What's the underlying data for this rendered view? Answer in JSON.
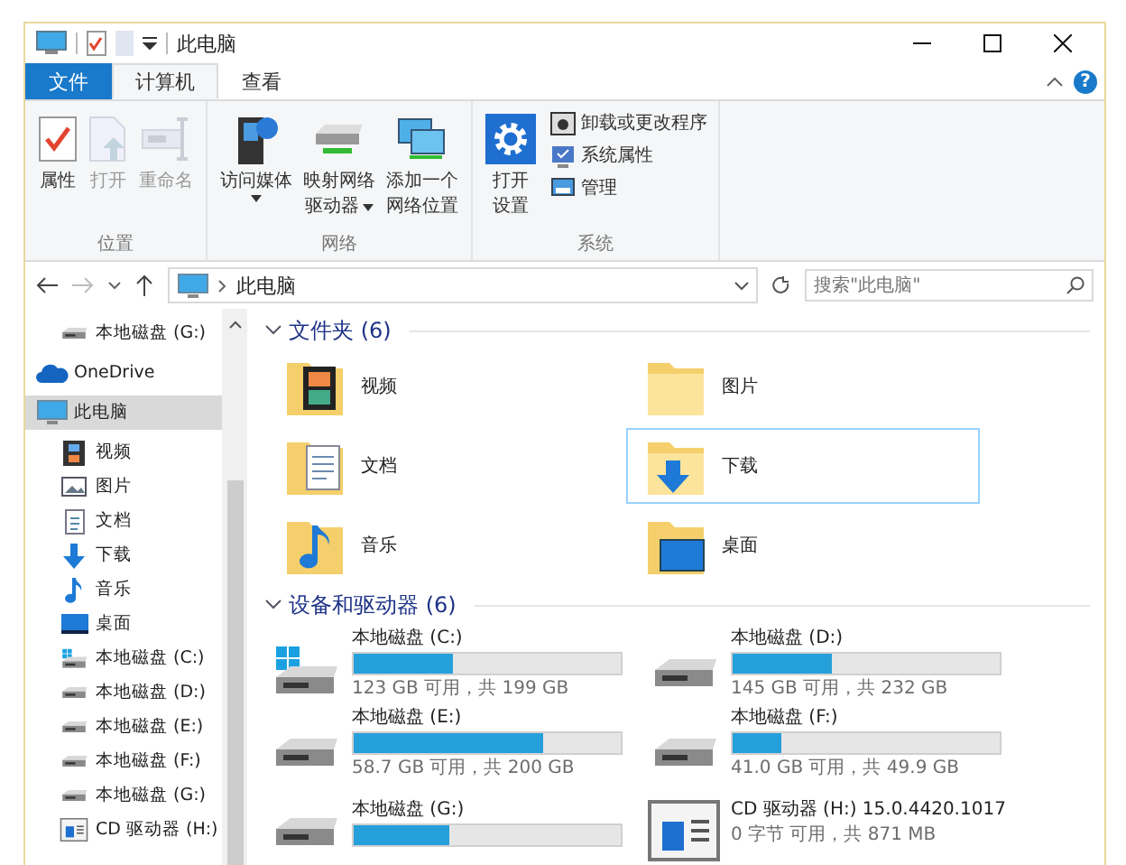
{
  "window": {
    "title": "此电脑"
  },
  "tabs": [
    {
      "label": "文件",
      "kind": "file",
      "selected": false
    },
    {
      "label": "计算机",
      "kind": "tab",
      "selected": true
    },
    {
      "label": "查看",
      "kind": "tab",
      "selected": false
    }
  ],
  "help": "?",
  "ribbon": {
    "groups": [
      {
        "name": "位置",
        "items": [
          {
            "kind": "properties",
            "lines": [
              "属性"
            ],
            "disabled": false,
            "caret": false
          },
          {
            "kind": "open",
            "lines": [
              "打开"
            ],
            "disabled": true,
            "caret": false
          },
          {
            "kind": "rename",
            "lines": [
              "重命名"
            ],
            "disabled": true,
            "caret": false
          }
        ]
      },
      {
        "name": "网络",
        "items": [
          {
            "kind": "media",
            "lines": [
              "访问媒体"
            ],
            "disabled": false,
            "caret": true
          },
          {
            "kind": "mapdrive",
            "lines": [
              "映射网络",
              "驱动器"
            ],
            "disabled": false,
            "caret": true
          },
          {
            "kind": "addnet",
            "lines": [
              "添加一个",
              "网络位置"
            ],
            "disabled": false,
            "caret": false
          }
        ]
      },
      {
        "name": "系统",
        "items": [
          {
            "kind": "settings",
            "lines": [
              "打开",
              "设置"
            ],
            "disabled": false,
            "caret": false
          }
        ],
        "small": [
          {
            "kind": "uninstall",
            "label": "卸载或更改程序"
          },
          {
            "kind": "sysprops",
            "label": "系统属性"
          },
          {
            "kind": "manage",
            "label": "管理"
          }
        ]
      }
    ]
  },
  "address": {
    "path": "此电脑",
    "search_placeholder": "搜索\"此电脑\""
  },
  "sidebar": {
    "items": [
      {
        "label": "本地磁盘 (G:)",
        "kind": "drive",
        "selected": false
      },
      {
        "label": "OneDrive",
        "kind": "cloud",
        "selected": false
      },
      {
        "label": "此电脑",
        "kind": "pc",
        "selected": true,
        "children": [
          {
            "label": "视频",
            "kind": "video",
            "selected": false
          },
          {
            "label": "图片",
            "kind": "picture",
            "selected": false
          },
          {
            "label": "文档",
            "kind": "doc",
            "selected": false
          },
          {
            "label": "下载",
            "kind": "download",
            "selected": false
          },
          {
            "label": "音乐",
            "kind": "music",
            "selected": false
          },
          {
            "label": "桌面",
            "kind": "desktop",
            "selected": false
          },
          {
            "label": "本地磁盘 (C:)",
            "kind": "sysdrive",
            "selected": false
          },
          {
            "label": "本地磁盘 (D:)",
            "kind": "drive",
            "selected": false
          },
          {
            "label": "本地磁盘 (E:)",
            "kind": "drive",
            "selected": false
          },
          {
            "label": "本地磁盘 (F:)",
            "kind": "drive",
            "selected": false
          },
          {
            "label": "本地磁盘 (G:)",
            "kind": "drive",
            "selected": false
          },
          {
            "label": "CD 驱动器 (H:)",
            "kind": "cd",
            "selected": false
          }
        ]
      }
    ]
  },
  "folders": {
    "header": "文件夹 (6)",
    "expanded": true,
    "items": [
      {
        "label": "视频",
        "kind": "video",
        "selected": false
      },
      {
        "label": "图片",
        "kind": "picture",
        "selected": false
      },
      {
        "label": "文档",
        "kind": "doc",
        "selected": false
      },
      {
        "label": "下载",
        "kind": "download",
        "selected": true
      },
      {
        "label": "音乐",
        "kind": "music",
        "selected": false
      },
      {
        "label": "桌面",
        "kind": "desktop",
        "selected": false
      }
    ]
  },
  "devices": {
    "header": "设备和驱动器 (6)",
    "expanded": true,
    "items": [
      {
        "label": "本地磁盘 (C:)",
        "kind": "sysdrive",
        "level": 0.37,
        "usage": "123 GB 可用，共 199 GB"
      },
      {
        "label": "本地磁盘 (D:)",
        "kind": "drive",
        "level": 0.37,
        "usage": "145 GB 可用，共 232 GB"
      },
      {
        "label": "本地磁盘 (E:)",
        "kind": "drive",
        "level": 0.71,
        "usage": "58.7 GB 可用，共 200 GB"
      },
      {
        "label": "本地磁盘 (F:)",
        "kind": "drive",
        "level": 0.18,
        "usage": "41.0 GB 可用，共 49.9 GB"
      },
      {
        "label": "本地磁盘 (G:)",
        "kind": "drive",
        "level": 0.36
      },
      {
        "label": "CD 驱动器 (H:) 15.0.4420.1017",
        "kind": "cd",
        "usage": "0 字节 可用，共 871 MB"
      }
    ]
  }
}
